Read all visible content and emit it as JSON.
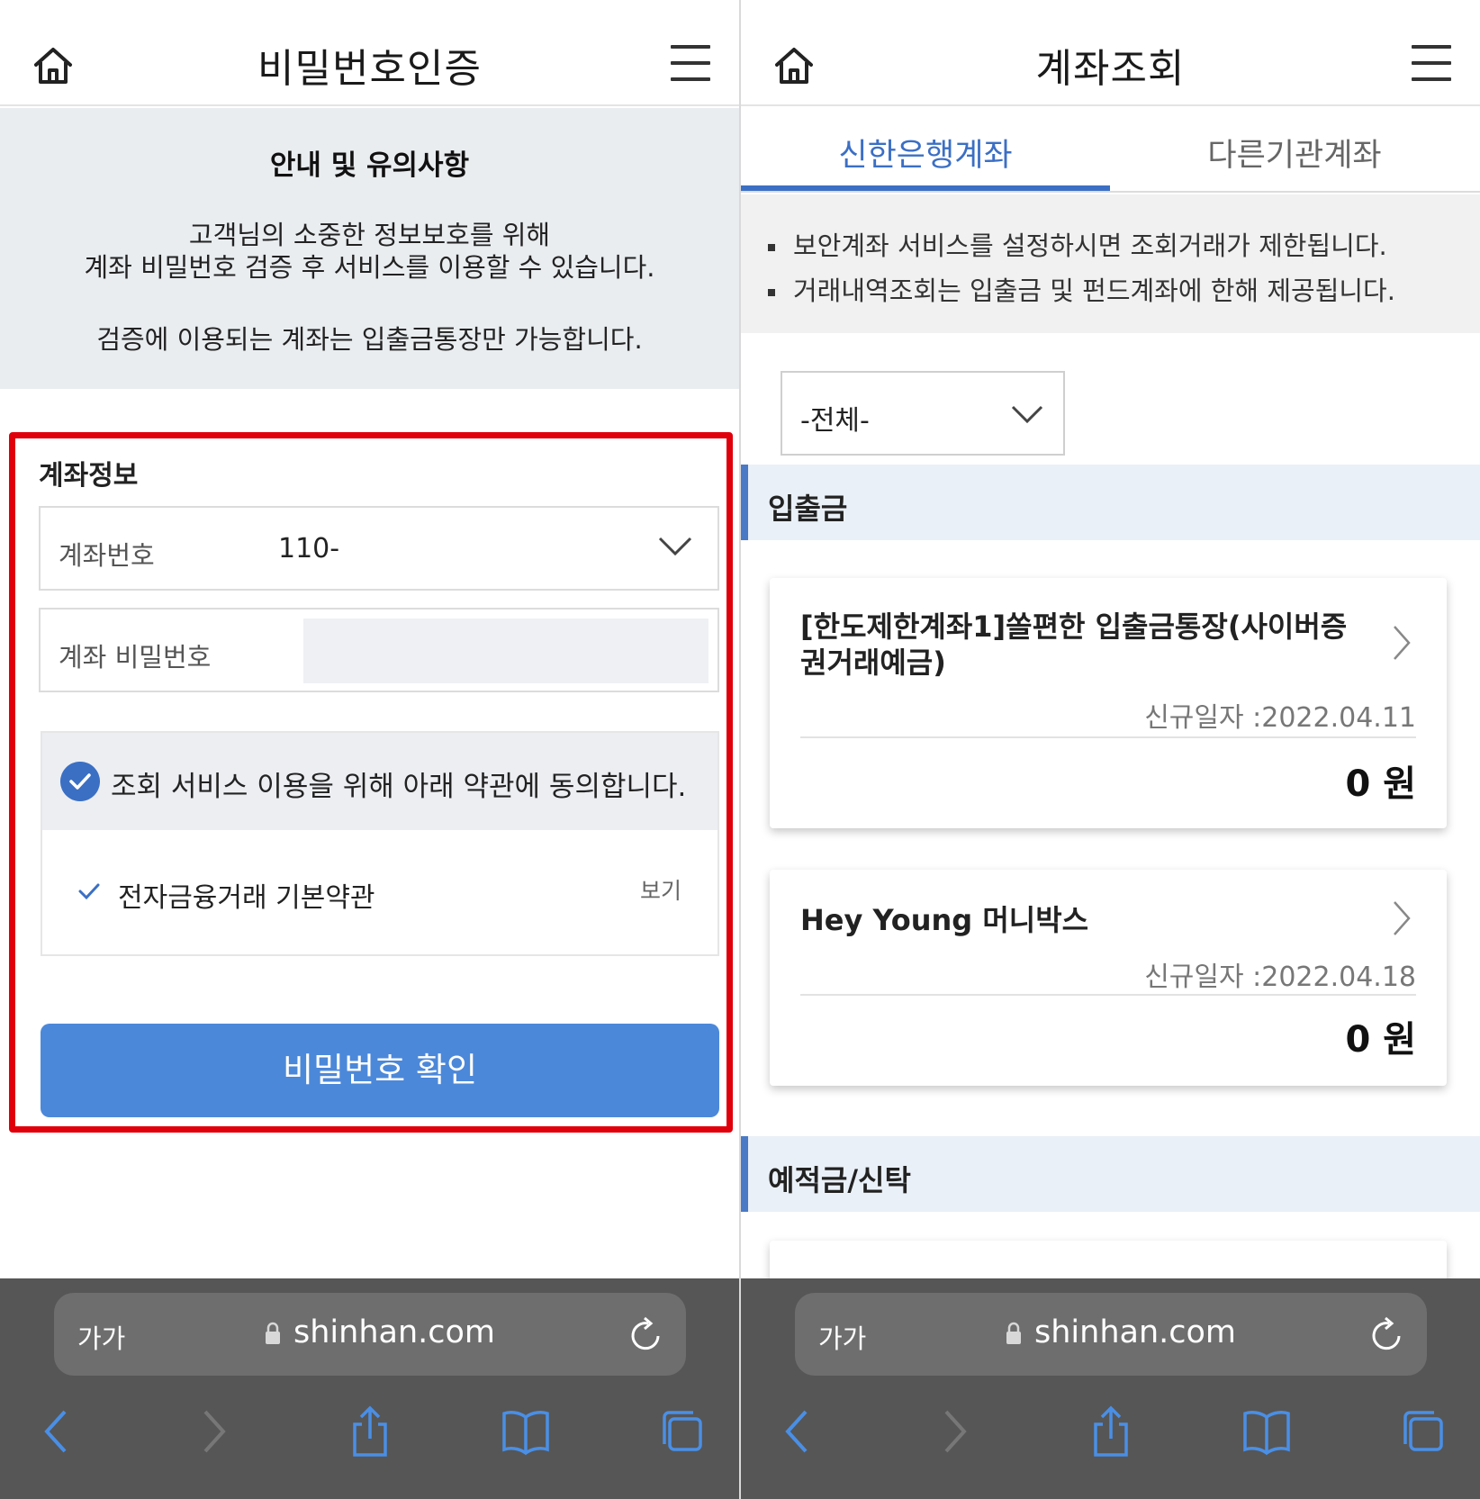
{
  "left": {
    "header": {
      "title": "비밀번호인증"
    },
    "notice": {
      "title": "안내 및 유의사항",
      "line1": "고객님의 소중한 정보보호를 위해",
      "line2": "계좌 비밀번호 검증 후 서비스를 이용할 수 있습니다.",
      "line3": "검증에 이용되는 계좌는 입출금통장만 가능합니다."
    },
    "account_info": {
      "title": "계좌정보",
      "account_label": "계좌번호",
      "account_value": "110-",
      "password_label": "계좌 비밀번호"
    },
    "agreement": {
      "text": "조회 서비스 이용을 위해 아래 약관에 동의합니다.",
      "item": "전자금융거래 기본약관",
      "view": "보기"
    },
    "confirm_button": "비밀번호 확인",
    "browser": {
      "text_size": "가가",
      "domain": "shinhan.com"
    }
  },
  "right": {
    "header": {
      "title": "계좌조회"
    },
    "tabs": [
      "신한은행계좌",
      "다른기관계좌"
    ],
    "notices": [
      "보안계좌 서비스를 설정하시면 조회거래가 제한됩니다.",
      "거래내역조회는 입출금 및 펀드계좌에 한해 제공됩니다."
    ],
    "filter": "-전체-",
    "section1": "입출금",
    "accounts": [
      {
        "name": "[한도제한계좌1]쏠편한 입출금통장(사이버증권거래예금)",
        "date": "신규일자 :2022.04.11",
        "amount": "0 원"
      },
      {
        "name": "Hey Young 머니박스",
        "date": "신규일자 :2022.04.18",
        "amount": "0 원"
      }
    ],
    "section2": "예적금/신탁",
    "browser": {
      "text_size": "가가",
      "domain": "shinhan.com"
    }
  },
  "colors": {
    "accent": "#4c88d9",
    "tab_active": "#3b6fc4",
    "highlight_border": "#e0000b"
  },
  "icons": [
    "home-icon",
    "menu-icon",
    "chevron-down-icon",
    "check-circle-icon",
    "check-icon",
    "chevron-right-icon",
    "lock-icon",
    "reload-icon",
    "back-icon",
    "forward-icon",
    "share-icon",
    "bookmarks-icon",
    "tabs-icon"
  ]
}
